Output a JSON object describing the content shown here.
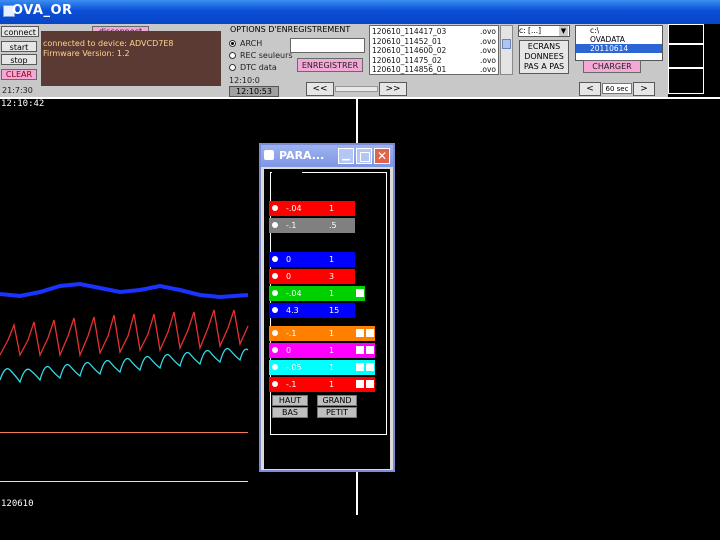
{
  "window": {
    "title": "OVA_OR"
  },
  "toolbar": {
    "connect": "connect",
    "disconnect": "disconnect",
    "start": "start",
    "stop": "stop",
    "clear": "CLEAR",
    "clock": "21:7:30"
  },
  "message": {
    "line1": "connected to device: ADVCD7E8",
    "line2": "Firmware Version: 1.2"
  },
  "options": {
    "title": "OPTIONS D'ENREGISTREMENT",
    "radio1": "ARCH",
    "radio2": "REC seuleurs",
    "radio3": "DTC data",
    "btn_record": "ENREGISTRER",
    "small1": "12:10:0",
    "small2": "12:10:53"
  },
  "files": [
    {
      "name": "120610_114417_03",
      "ext": ".ovo"
    },
    {
      "name": "120610_11452_01",
      "ext": ".ovo"
    },
    {
      "name": "120610_114600_02",
      "ext": ".ovo"
    },
    {
      "name": "120610_11475_02",
      "ext": ".ovo"
    },
    {
      "name": "120610_114856_01",
      "ext": ".ovo"
    }
  ],
  "nav": {
    "prev": "<<",
    "next": ">>",
    "btn_data": "ECRANS DONNEES PAS A PAS",
    "btn_load": "CHARGER",
    "small_prev": "<",
    "small_next": ">",
    "interval": "60 sec"
  },
  "drive": "c: [...]",
  "dirs": {
    "d1": "c:\\",
    "d2": "OVADATA",
    "d3": "20110614"
  },
  "plot": {
    "time_top": "12:10:42",
    "date_bottom": "120610"
  },
  "params": {
    "title": "PARA...",
    "rows": [
      {
        "a": "-.04",
        "b": "1",
        "color": "#ff0000"
      },
      {
        "a": "-.1",
        "b": ".5",
        "color": "#808080"
      },
      {
        "a": "0",
        "b": "1",
        "color": "#0000ff"
      },
      {
        "a": "0",
        "b": "3",
        "color": "#ff0000"
      },
      {
        "a": "-.04",
        "b": "1",
        "color": "#00d000"
      },
      {
        "a": "4.3",
        "b": "15",
        "color": "#0000ff"
      },
      {
        "a": "-.1",
        "b": "1",
        "color": "#ff8000"
      },
      {
        "a": "0",
        "b": "1",
        "color": "#ff00ff"
      },
      {
        "a": "-.05",
        "b": "1",
        "color": "#00ffff"
      },
      {
        "a": "-.1",
        "b": "1",
        "color": "#ff0000"
      }
    ],
    "btn_up": "HAUT",
    "btn_down": "BAS",
    "btn_big": "GRAND",
    "btn_small": "PETIT"
  }
}
